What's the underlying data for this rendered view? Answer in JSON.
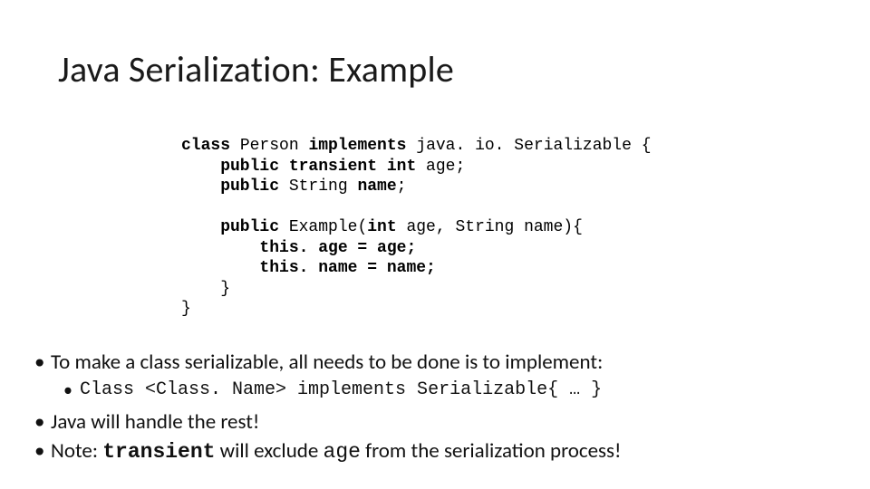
{
  "title": "Java Serialization: Example",
  "code": {
    "l1a": "class",
    "l1b": " Person ",
    "l1c": "implements",
    "l1d": " java. io. Serializable {",
    "l2a": "    public transient int",
    "l2b": " age;",
    "l3a": "    public",
    "l3b": " String ",
    "l3c": "name",
    "l3d": ";",
    "blank1": "",
    "l4a": "    public",
    "l4b": " Example(",
    "l4c": "int",
    "l4d": " age, String name){",
    "l5": "        this. age = age;",
    "l6": "        this. name = name;",
    "l7": "    }",
    "l8": "}"
  },
  "bullets": {
    "b1": "To make a class serializable, all needs to be done is to implement:",
    "b2": "Class <Class. Name> implements Serializable{ … }",
    "b3": "Java will handle the rest!",
    "b4_pre": "Note: ",
    "b4_kw": "transient",
    "b4_mid": " will exclude ",
    "b4_code": "age",
    "b4_post": " from the serialization process!"
  }
}
